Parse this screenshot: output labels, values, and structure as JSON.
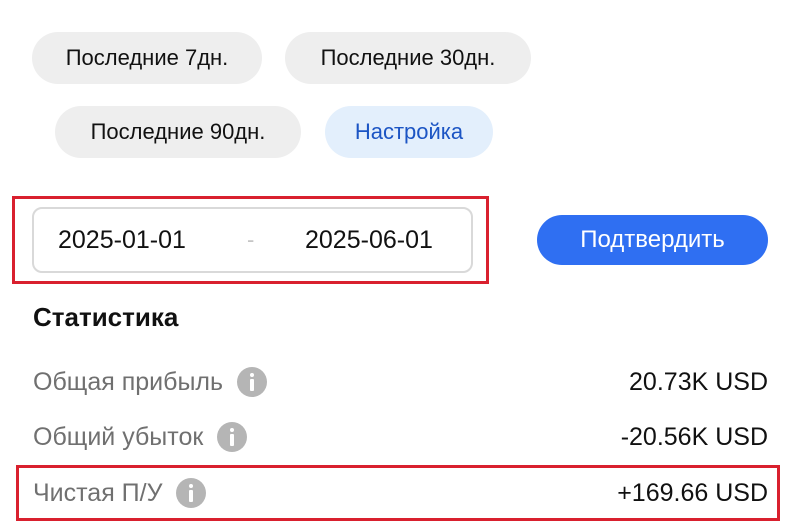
{
  "period_filters": {
    "chips": [
      {
        "label": "Последние 7дн."
      },
      {
        "label": "Последние 30дн."
      },
      {
        "label": "Последние 90дн."
      },
      {
        "label": "Настройка"
      }
    ],
    "selected": "Настройка"
  },
  "date_range": {
    "start": "2025-01-01",
    "separator": "-",
    "end": "2025-06-01"
  },
  "confirm_button": {
    "label": "Подтвердить"
  },
  "statistics": {
    "title": "Статистика",
    "rows": [
      {
        "label": "Общая прибыль",
        "value": "20.73K USD",
        "icon": "info-icon"
      },
      {
        "label": "Общий убыток",
        "value": "-20.56K USD",
        "icon": "info-icon"
      },
      {
        "label": "Чистая П/У",
        "value": "+169.66 USD",
        "icon": "info-icon"
      }
    ]
  },
  "colors": {
    "accent": "#2f6ff2",
    "selected_chip_bg": "#e3effc",
    "selected_chip_text": "#1c55c4",
    "highlight_border": "#d9202e"
  }
}
